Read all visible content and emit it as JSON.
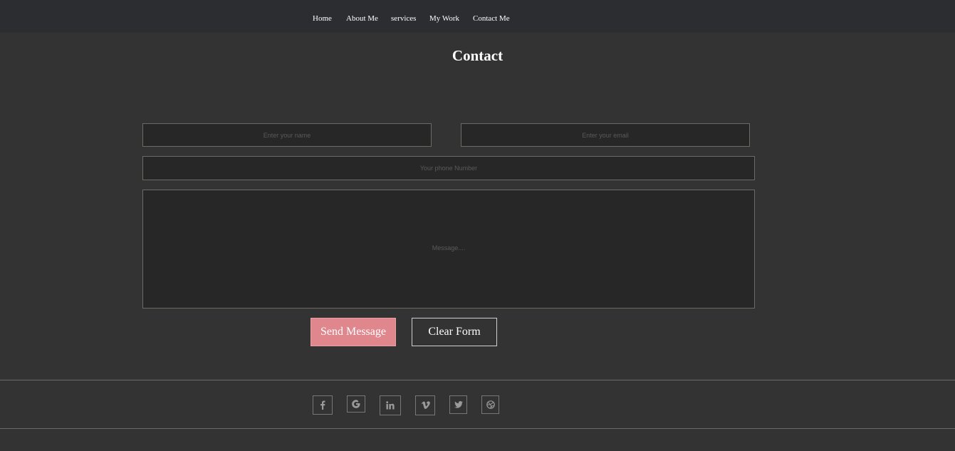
{
  "nav": {
    "items": [
      {
        "label": "Home"
      },
      {
        "label": "About Me"
      },
      {
        "label": "services"
      },
      {
        "label": "My Work"
      },
      {
        "label": "Contact Me"
      }
    ]
  },
  "page": {
    "title": "Contact"
  },
  "form": {
    "name_placeholder": "Enter your name",
    "email_placeholder": "Enter your email",
    "phone_placeholder": "Your phone Number",
    "message_placeholder": "Message....",
    "send_label": "Send Message",
    "clear_label": "Clear Form"
  },
  "social": {
    "icons": [
      "facebook-icon",
      "google-icon",
      "linkedin-icon",
      "vimeo-icon",
      "twitter-icon",
      "dribbble-icon"
    ]
  },
  "colors": {
    "background": "#333333",
    "nav_background": "#2c2d30",
    "accent": "#e0868d",
    "field_background": "#272727",
    "field_border": "#6d6a64"
  }
}
